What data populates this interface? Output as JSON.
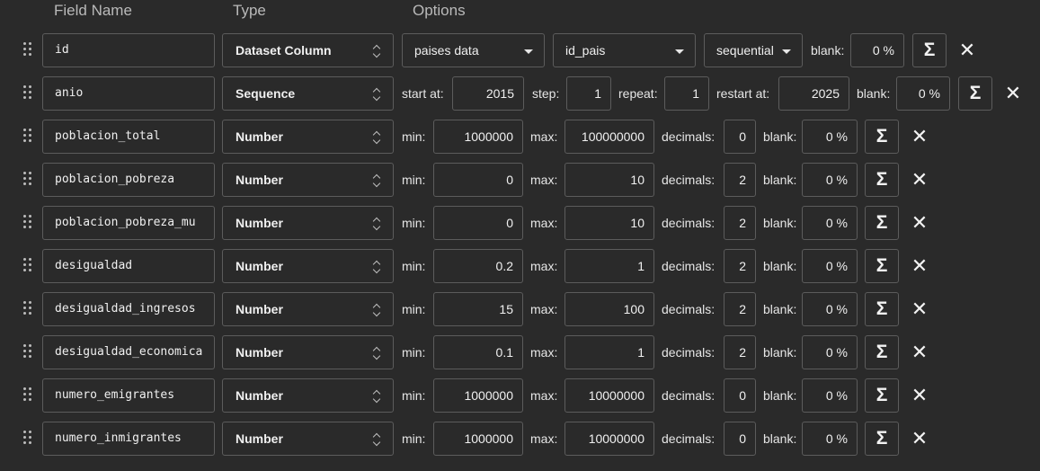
{
  "headers": {
    "field_name": "Field Name",
    "type": "Type",
    "options": "Options"
  },
  "icons": {
    "sigma": "Σ",
    "close": "✕"
  },
  "rows": [
    {
      "field": "id",
      "type": "Dataset Column",
      "dataset": "paises data",
      "column": "id_pais",
      "mode": "sequential",
      "blank_label": "blank:",
      "blank": "0 %"
    },
    {
      "field": "anio",
      "type": "Sequence",
      "start_label": "start at:",
      "start": "2015",
      "step_label": "step:",
      "step": "1",
      "repeat_label": "repeat:",
      "repeat": "1",
      "restart_label": "restart at:",
      "restart": "2025",
      "blank_label": "blank:",
      "blank": "0 %"
    },
    {
      "field": "poblacion_total",
      "type": "Number",
      "min_label": "min:",
      "min": "1000000",
      "max_label": "max:",
      "max": "100000000",
      "dec_label": "decimals:",
      "dec": "0",
      "blank_label": "blank:",
      "blank": "0 %"
    },
    {
      "field": "poblacion_pobreza",
      "type": "Number",
      "min_label": "min:",
      "min": "0",
      "max_label": "max:",
      "max": "10",
      "dec_label": "decimals:",
      "dec": "2",
      "blank_label": "blank:",
      "blank": "0 %"
    },
    {
      "field": "poblacion_pobreza_mu",
      "type": "Number",
      "min_label": "min:",
      "min": "0",
      "max_label": "max:",
      "max": "10",
      "dec_label": "decimals:",
      "dec": "2",
      "blank_label": "blank:",
      "blank": "0 %"
    },
    {
      "field": "desigualdad",
      "type": "Number",
      "min_label": "min:",
      "min": "0.2",
      "max_label": "max:",
      "max": "1",
      "dec_label": "decimals:",
      "dec": "2",
      "blank_label": "blank:",
      "blank": "0 %"
    },
    {
      "field": "desigualdad_ingresos",
      "type": "Number",
      "min_label": "min:",
      "min": "15",
      "max_label": "max:",
      "max": "100",
      "dec_label": "decimals:",
      "dec": "2",
      "blank_label": "blank:",
      "blank": "0 %"
    },
    {
      "field": "desigualdad_economica",
      "type": "Number",
      "min_label": "min:",
      "min": "0.1",
      "max_label": "max:",
      "max": "1",
      "dec_label": "decimals:",
      "dec": "2",
      "blank_label": "blank:",
      "blank": "0 %"
    },
    {
      "field": "numero_emigrantes",
      "type": "Number",
      "min_label": "min:",
      "min": "1000000",
      "max_label": "max:",
      "max": "10000000",
      "dec_label": "decimals:",
      "dec": "0",
      "blank_label": "blank:",
      "blank": "0 %"
    },
    {
      "field": "numero_inmigrantes",
      "type": "Number",
      "min_label": "min:",
      "min": "1000000",
      "max_label": "max:",
      "max": "10000000",
      "dec_label": "decimals:",
      "dec": "0",
      "blank_label": "blank:",
      "blank": "0 %"
    }
  ]
}
